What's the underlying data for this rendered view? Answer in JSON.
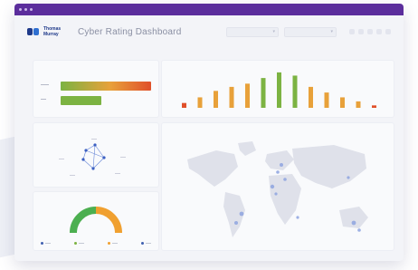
{
  "app": {
    "brand_line1": "Thomas",
    "brand_line2": "Murray",
    "title": "Cyber Rating Dashboard"
  },
  "colors": {
    "titlebar": "#5b2d9c",
    "bar_red": "#e0502a",
    "bar_orange": "#e8a13a",
    "bar_green": "#7cb342",
    "gauge_green": "#4caf50",
    "gauge_orange": "#f0a030",
    "map_land": "#dfe1ea",
    "map_points": "#8ea4e0"
  },
  "panels": {
    "horizontal_bars": {
      "bars": [
        {
          "value": 100,
          "color": "#e07a2a"
        },
        {
          "value": 45,
          "color": "#7cb342"
        }
      ]
    },
    "monthly_bars": {
      "values": [
        6,
        13,
        21,
        26,
        30,
        37,
        44,
        40,
        26,
        19,
        13,
        8,
        3
      ],
      "colors": [
        "#e0502a",
        "#e8a13a",
        "#e8a13a",
        "#e8a13a",
        "#e8a13a",
        "#7cb342",
        "#7cb342",
        "#7cb342",
        "#e8a13a",
        "#e8a13a",
        "#e8a13a",
        "#e8a13a",
        "#e0502a"
      ]
    },
    "network": {
      "nodes": 8
    },
    "gauge": {
      "legend": [
        {
          "color": "#4060b0"
        },
        {
          "color": "#7cb342"
        },
        {
          "color": "#f0a030"
        },
        {
          "color": "#4060b0"
        }
      ]
    }
  }
}
